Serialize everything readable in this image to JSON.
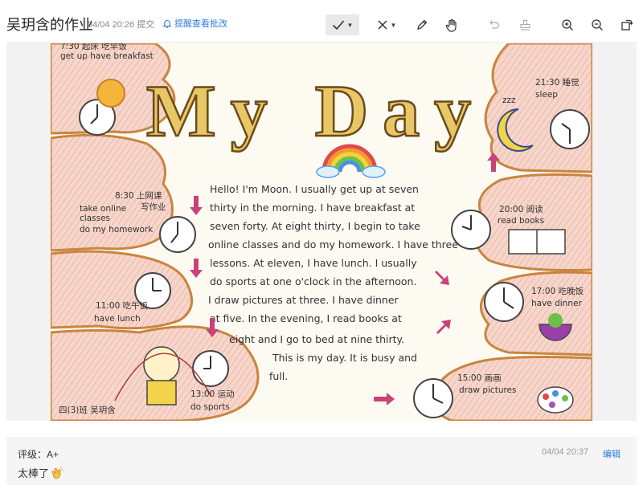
{
  "header": {
    "title": "吴玥含的作业",
    "submit_time": "04/04 20:26 提交",
    "remind_label": "提醒查看批改"
  },
  "toolbar": {
    "tools": [
      "check-tool",
      "cross-tool",
      "pen-tool",
      "hand-tool",
      "undo-tool",
      "stamp-tool",
      "zoom-in-tool",
      "zoom-out-tool",
      "rotate-tool"
    ],
    "active_tool": "check-tool"
  },
  "artwork": {
    "title": "My Day",
    "paragraph": [
      "Hello! I'm Moon. I usually get up at seven",
      "thirty in the morning. I have breakfast at",
      "seven forty. At eight thirty, I begin to take",
      "online classes and do my homework. I have three",
      "lessons. At eleven, I have lunch. I usually",
      "do sports at one o'clock in the afternoon.",
      "I draw pictures at three. I have dinner",
      "at five. In the evening, I read books at",
      "eight and I go to bed at nine thirty.",
      "This is my day. It is busy and",
      "full."
    ],
    "labels": {
      "breakfast_a": "7:30 起床 吃早饭",
      "breakfast_b": "get up have breakfast",
      "class_a": "8:30 上网课",
      "class_b": "写作业",
      "class_c": "take online",
      "class_d": "classes",
      "class_e": "do my homework",
      "lunch_a": "11:00 吃午饭",
      "lunch_b": "have lunch",
      "sport_a": "13:00 运动",
      "sport_b": "do sports",
      "sleep_a": "21:30 睡觉",
      "sleep_b": "sleep",
      "read_a": "20:00 阅读",
      "read_b": "read books",
      "dinner_a": "17:00 吃晚饭",
      "dinner_b": "have dinner",
      "draw_a": "15:00 画画",
      "draw_b": "draw pictures",
      "signature": "四(3)班 吴玥含",
      "zzz": "zzz"
    }
  },
  "review": {
    "grade_label": "评级：A+",
    "comment": "太棒了",
    "time": "04/04 20:37",
    "edit_label": "编辑"
  },
  "colors": {
    "accent": "#2f7be0",
    "title_yellow": "#e8c766",
    "cloud_border": "#c9853f",
    "cloud_fill": "#f2c9bb",
    "arrow": "#c8437a"
  }
}
